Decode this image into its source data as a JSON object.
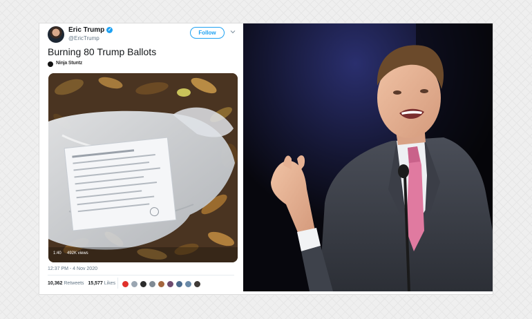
{
  "tweet": {
    "author_name": "Eric Trump",
    "verified_icon": "verified-badge-icon",
    "handle": "@EricTrump",
    "follow_label": "Follow",
    "text": "Burning 80 Trump Ballots",
    "watermark_text": "Ninja Stuntz",
    "video": {
      "duration": "1:40",
      "views": "492K views"
    },
    "timestamp": "12:37 PM - 4 Nov 2020",
    "retweets_count": "10,362",
    "retweets_label": "Retweets",
    "likes_count": "15,577",
    "likes_label": "Likes"
  },
  "colors": {
    "twitter_blue": "#1da1f2",
    "muted_text": "#657786",
    "primary_text": "#14171a",
    "tie_pink": "#e07aa0"
  }
}
